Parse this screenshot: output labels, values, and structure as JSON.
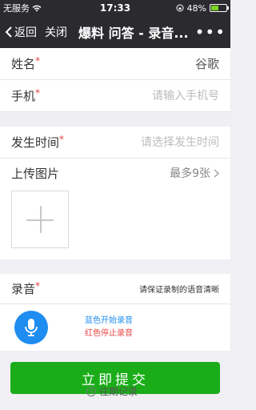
{
  "status": {
    "carrier": "无服务",
    "time": "17:33",
    "battery": "48%",
    "battery_level": 0.48
  },
  "nav": {
    "back": "返回",
    "close": "关闭",
    "title": "爆料 问答 - 录音...",
    "more": "•••"
  },
  "form": {
    "name": {
      "label": "姓名",
      "required": "*",
      "value": "谷歌"
    },
    "phone": {
      "label": "手机",
      "required": "*",
      "placeholder": "请输入手机号"
    },
    "time": {
      "label": "发生时间",
      "required": "*",
      "placeholder": "请选择发生时间"
    },
    "images": {
      "label": "上传图片",
      "hint": "最多9张"
    },
    "audio": {
      "label": "录音",
      "required": "*",
      "note": "请保证录制的语音清晰",
      "tip_blue": "蓝色开始录音",
      "tip_red": "红色停止录音"
    }
  },
  "footer": {
    "submit": "立即提交",
    "history": "往期记录"
  },
  "colors": {
    "accent": "#1aad19",
    "mic": "#1e8cf0",
    "required": "#e64340"
  }
}
